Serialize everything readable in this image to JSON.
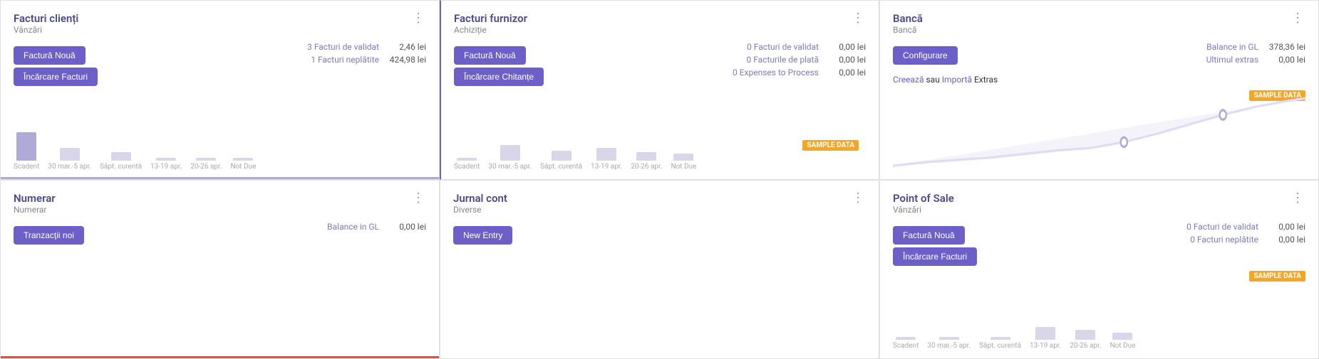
{
  "cards": [
    {
      "id": "facturi-clienti",
      "title": "Facturi clienți",
      "subtitle": "Vânzări",
      "buttons": [
        {
          "label": "Factură Nouă",
          "name": "factura-noua-btn-1"
        },
        {
          "label": "Încărcare Facturi",
          "name": "incarcare-facturi-btn-1"
        }
      ],
      "stats": [
        {
          "label": "3 Facturi de validat",
          "value": "2,46 lei"
        },
        {
          "label": "1 Facturi neplătite",
          "value": "424,98 lei"
        }
      ],
      "chart": {
        "bars": [
          {
            "height": 40,
            "label": "Scadent"
          },
          {
            "height": 18,
            "label": "30 mar.-5 apr."
          },
          {
            "height": 12,
            "label": "Săpt. curentă"
          },
          {
            "height": 0,
            "label": "13-19 apr."
          },
          {
            "height": 0,
            "label": "20-26 apr."
          },
          {
            "height": 0,
            "label": "Not Due"
          }
        ]
      },
      "sampleData": false,
      "bottomBar": "purple",
      "position": "top-left"
    },
    {
      "id": "facturi-furnizor",
      "title": "Facturi furnizor",
      "subtitle": "Achiziție",
      "buttons": [
        {
          "label": "Factură Nouă",
          "name": "factura-noua-btn-2"
        },
        {
          "label": "Încărcare Chitanțe",
          "name": "incarcare-chitante-btn"
        }
      ],
      "stats": [
        {
          "label": "0 Facturi de validat",
          "value": "0,00 lei"
        },
        {
          "label": "0 Facturile de plată",
          "value": "0,00 lei"
        },
        {
          "label": "0 Expenses to Process",
          "value": "0,00 lei"
        }
      ],
      "chart": {
        "bars": [
          {
            "height": 0,
            "label": "Scadent"
          },
          {
            "height": 22,
            "label": "30 mar.-5 apr."
          },
          {
            "height": 14,
            "label": "Săpt. curentă"
          },
          {
            "height": 18,
            "label": "13-19 apr."
          },
          {
            "height": 12,
            "label": "20-26 apr."
          },
          {
            "height": 10,
            "label": "Not Due"
          }
        ]
      },
      "sampleData": true,
      "bottomBar": "none",
      "position": "top-center"
    },
    {
      "id": "banca",
      "title": "Bancă",
      "subtitle": "Bancă",
      "buttons": [
        {
          "label": "Configurare",
          "name": "configurare-btn"
        }
      ],
      "balanceLabel": "Balance in GL",
      "balanceValue": "378,36 lei",
      "extraLabel": "Ultimul extras",
      "extraValue": "0,00 lei",
      "linkText1": "Creează",
      "linkSep": " sau ",
      "linkText2": "Importă",
      "linkText3": " Extras",
      "sampleData": true,
      "bottomBar": "none",
      "position": "top-right",
      "hasLineChart": true
    },
    {
      "id": "numerar",
      "title": "Numerar",
      "subtitle": "Numerar",
      "buttons": [
        {
          "label": "Tranzacții noi",
          "name": "tranzactii-noi-btn"
        }
      ],
      "balanceLabel": "Balance in GL",
      "balanceValue": "0,00 lei",
      "sampleData": false,
      "bottomBar": "red",
      "position": "bottom-left"
    },
    {
      "id": "jurnal-cont",
      "title": "Jurnal cont",
      "subtitle": "Diverse",
      "buttons": [
        {
          "label": "New Entry",
          "name": "new-entry-btn"
        }
      ],
      "sampleData": false,
      "bottomBar": "none",
      "position": "bottom-center"
    },
    {
      "id": "point-of-sale",
      "title": "Point of Sale",
      "subtitle": "Vânzări",
      "buttons": [
        {
          "label": "Factură Nouă",
          "name": "factura-noua-btn-3"
        },
        {
          "label": "Încărcare Facturi",
          "name": "incarcare-facturi-btn-2"
        }
      ],
      "stats": [
        {
          "label": "0 Facturi de validat",
          "value": "0,00 lei"
        },
        {
          "label": "0 Facturi neplătite",
          "value": "0,00 lei"
        }
      ],
      "chart": {
        "bars": [
          {
            "height": 0,
            "label": "Scadent"
          },
          {
            "height": 0,
            "label": "30 mar.-5 apr."
          },
          {
            "height": 0,
            "label": "Săpt. curentă"
          },
          {
            "height": 18,
            "label": "13-19 apr."
          },
          {
            "height": 14,
            "label": "20-26 apr."
          },
          {
            "height": 10,
            "label": "Not Due"
          }
        ]
      },
      "sampleData": true,
      "bottomBar": "none",
      "position": "bottom-right"
    }
  ],
  "colors": {
    "accent": "#6c5fc7",
    "sample_badge": "#f5a623",
    "bar": "#d8d6e8",
    "bar_active": "#b0aad8"
  },
  "menu_dots": "⋮"
}
